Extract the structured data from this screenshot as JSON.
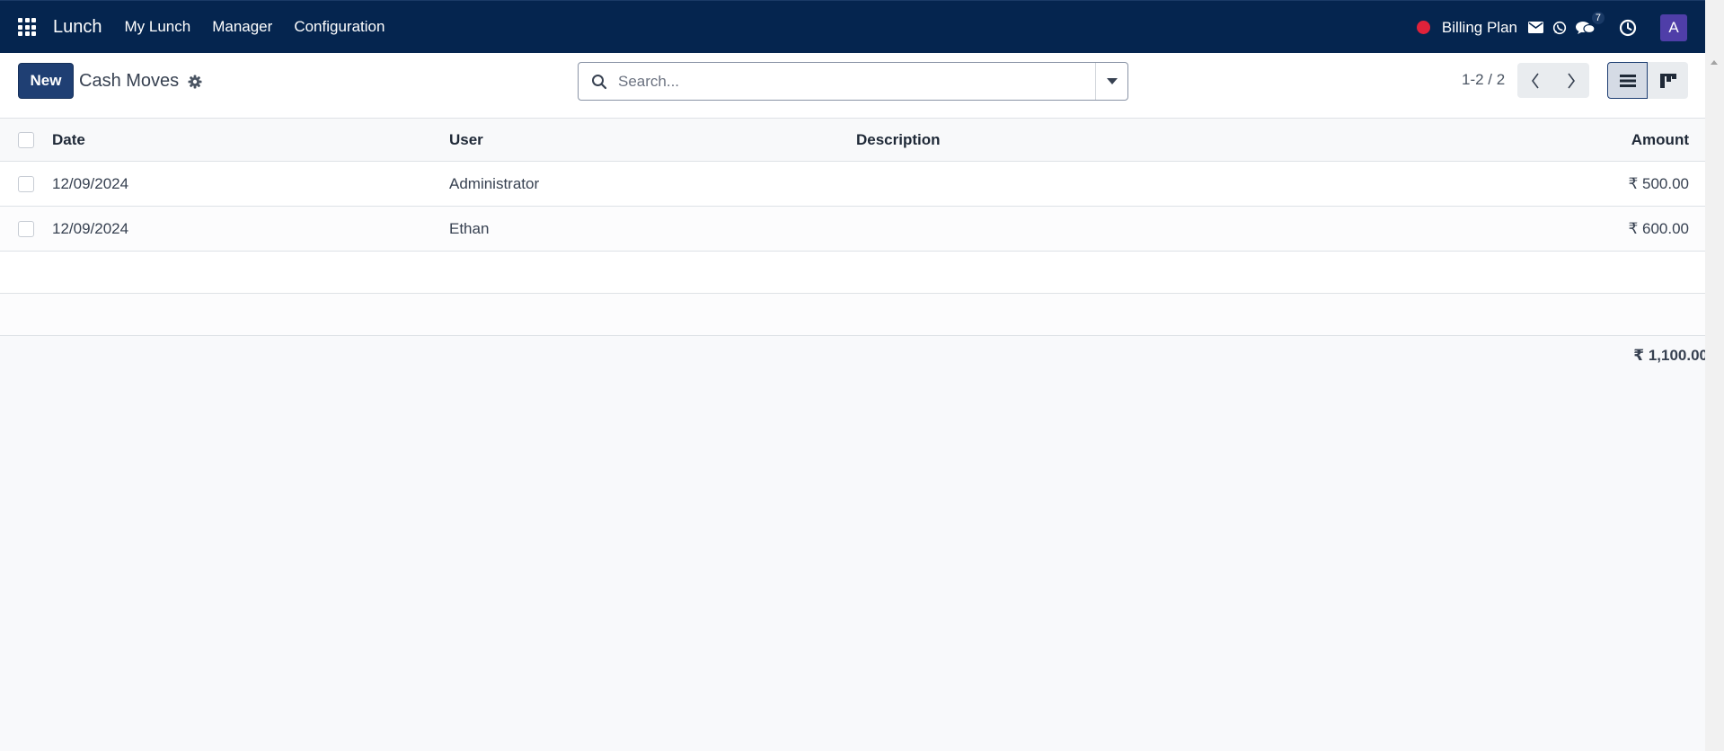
{
  "navbar": {
    "apps_icon": "grid-icon",
    "brand": "Lunch",
    "menu": [
      "My Lunch",
      "Manager",
      "Configuration"
    ],
    "billing": "Billing Plan",
    "message_count": "7",
    "avatar_letter": "A",
    "colors": {
      "navbar_bg": "#05254f",
      "status_dot": "#e0223a",
      "avatar_bg": "#4f3ea8"
    }
  },
  "control": {
    "new_label": "New",
    "title": "Cash Moves",
    "search_placeholder": "Search...",
    "pager": "1-2 / 2"
  },
  "table": {
    "headers": {
      "date": "Date",
      "user": "User",
      "description": "Description",
      "amount": "Amount"
    },
    "rows": [
      {
        "date": "12/09/2024",
        "user": "Administrator",
        "description": "",
        "amount": "₹ 500.00"
      },
      {
        "date": "12/09/2024",
        "user": "Ethan",
        "description": "",
        "amount": "₹ 600.00"
      }
    ],
    "total": "₹ 1,100.00"
  }
}
